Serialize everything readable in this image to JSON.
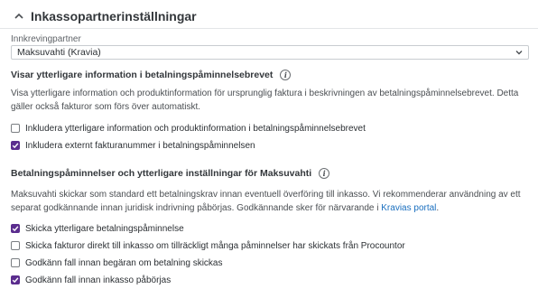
{
  "header": {
    "title": "Inkassopartnerinställningar",
    "collapse_icon": "chevron-up-icon"
  },
  "partner": {
    "label": "Innkrevingpartner",
    "selected": "Maksuvahti (Kravia)",
    "dropdown_icon": "chevron-down-icon"
  },
  "section1": {
    "title": "Visar ytterligare information i betalningspåminnelsebrevet",
    "info_icon": "info-icon",
    "description": "Visa ytterligare information och produktinformation för ursprunglig faktura i beskrivningen av betalningspåminnelsebrevet. Detta gäller också fakturor som förs över automatiskt.",
    "options": [
      {
        "label": "Inkludera ytterligare information och produktinformation i betalningspåminnelsebrevet",
        "checked": false
      },
      {
        "label": "Inkludera externt fakturanummer i betalningspåminnelsen",
        "checked": true
      }
    ]
  },
  "section2": {
    "title": "Betalningspåminnelser och ytterligare inställningar för Maksuvahti",
    "info_icon": "info-icon",
    "description_before_link": "Maksuvahti skickar som standard ett betalningskrav innan eventuell överföring till inkasso. Vi rekommenderar användning av ett separat godkännande innan juridisk indrivning påbörjas. Godkännande sker för närvarande i ",
    "link_text": "Kravias portal",
    "description_after_link": ".",
    "options": [
      {
        "label": "Skicka ytterligare betalningspåminnelse",
        "checked": true
      },
      {
        "label": "Skicka fakturor direkt till inkasso om tillräckligt många påminnelser har skickats från Procountor",
        "checked": false
      },
      {
        "label": "Godkänn fall innan begäran om betalning skickas",
        "checked": false
      },
      {
        "label": "Godkänn fall innan inkasso påbörjas",
        "checked": true
      }
    ]
  },
  "colors": {
    "accent": "#5b2d8e",
    "link": "#1a6fbf",
    "text": "#2b2f33"
  }
}
